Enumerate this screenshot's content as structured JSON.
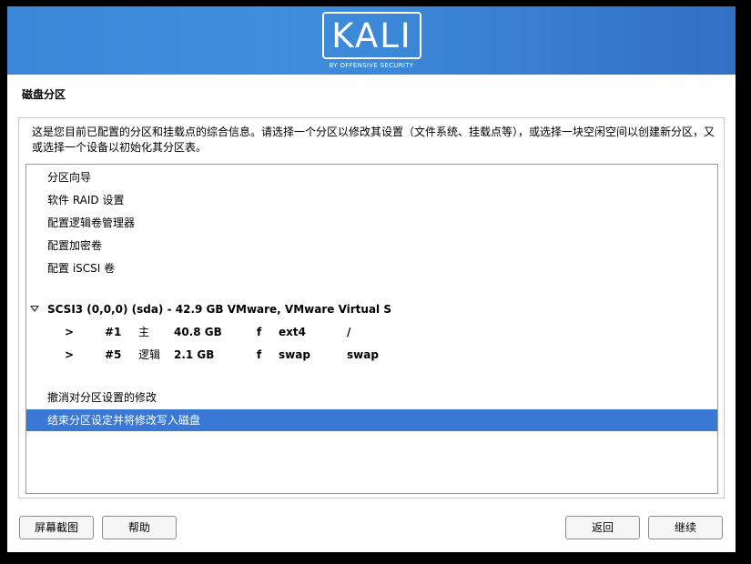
{
  "banner": {
    "logo_text": "KALI",
    "logo_subtitle": "BY OFFENSIVE SECURITY",
    "gradient_colors": [
      "#3a86d8",
      "#3170c2"
    ]
  },
  "page": {
    "title": "磁盘分区",
    "description": "这是您目前已配置的分区和挂载点的综合信息。请选择一个分区以修改其设置（文件系统、挂载点等），或选择一块空闲空间以创建新分区，又或选择一个设备以初始化其分区表。"
  },
  "menu_items": [
    {
      "label": "分区向导"
    },
    {
      "label": "软件 RAID 设置"
    },
    {
      "label": "配置逻辑卷管理器"
    },
    {
      "label": "配置加密卷"
    },
    {
      "label": "配置 iSCSI 卷"
    }
  ],
  "disk": {
    "label": "SCSI3 (0,0,0) (sda) - 42.9 GB VMware, VMware Virtual S",
    "partitions": [
      {
        "arrow": ">",
        "number": "#1",
        "type": "主",
        "size": "40.8 GB",
        "flag": "f",
        "filesystem": "ext4",
        "mount": "/"
      },
      {
        "arrow": ">",
        "number": "#5",
        "type": "逻辑",
        "size": "2.1 GB",
        "flag": "f",
        "filesystem": "swap",
        "mount": "swap"
      }
    ]
  },
  "actions": [
    {
      "label": "撤消对分区设置的修改"
    },
    {
      "label": "结束分区设定并将修改写入磁盘",
      "selected": true
    }
  ],
  "buttons": {
    "screenshot": "屏幕截图",
    "help": "帮助",
    "back": "返回",
    "continue": "继续"
  },
  "colors": {
    "selection": "#3a78d6",
    "selection_text": "#ffffff"
  }
}
